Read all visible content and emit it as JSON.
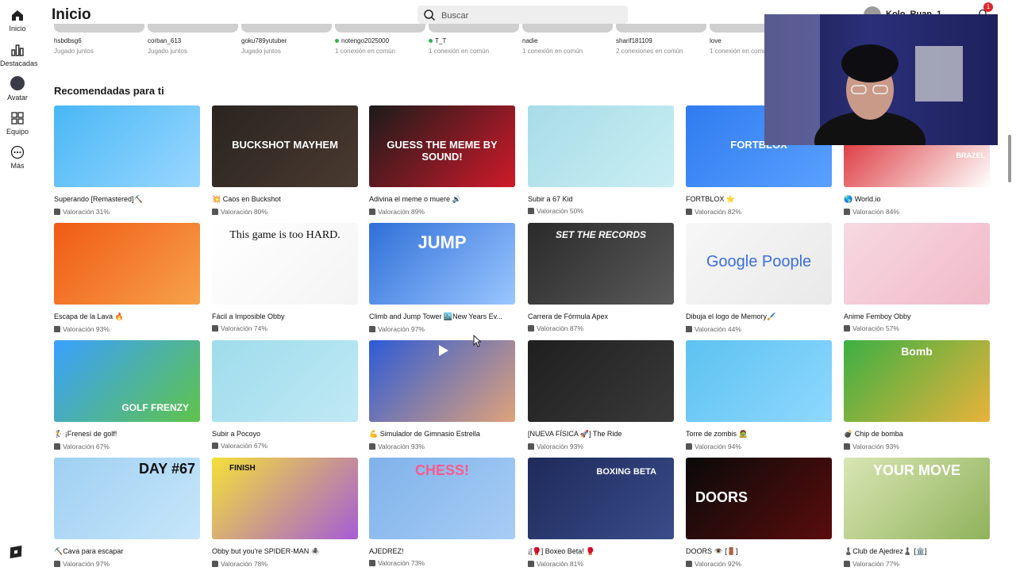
{
  "app": {
    "page_title": "Inicio",
    "user_name": "Kolo_Ruan_1",
    "notifications": "1"
  },
  "search": {
    "placeholder": "Buscar"
  },
  "sidebar": {
    "items": [
      {
        "label": "Inicio",
        "icon": "home-icon"
      },
      {
        "label": "Destacadas",
        "icon": "charts-icon"
      },
      {
        "label": "Avatar",
        "icon": "avatar-icon"
      },
      {
        "label": "Equipo",
        "icon": "inventory-icon"
      },
      {
        "label": "Más",
        "icon": "more-icon"
      }
    ]
  },
  "friends": [
    {
      "name": "hsbdbsg6",
      "status": "Jugado juntos",
      "online": false
    },
    {
      "name": "corban_613",
      "status": "Jugado juntos",
      "online": false
    },
    {
      "name": "goku789yutuber",
      "status": "Jugado juntos",
      "online": false
    },
    {
      "name": "notengo2025000",
      "status": "1 conexión en común",
      "online": true
    },
    {
      "name": "T_T",
      "status": "1 conexión en común",
      "online": true
    },
    {
      "name": "nadie",
      "status": "1 conexión en común",
      "online": false
    },
    {
      "name": "sharif181109",
      "status": "2 conexiones en común",
      "online": false
    },
    {
      "name": "love",
      "status": "1 conexión en común",
      "online": false
    }
  ],
  "recommended": {
    "title": "Recomendadas para ti",
    "games": [
      {
        "title": "Superando [Remastered]⛏️",
        "rating": "Valoración 31%",
        "thumb_text": "",
        "colors": [
          "#49b7f5",
          "#9ad7ff"
        ]
      },
      {
        "title": "💥 Caos en Buckshot",
        "rating": "Valoración 80%",
        "thumb_text": "BUCKSHOT MAYHEM",
        "colors": [
          "#2a2420",
          "#4a3a30"
        ]
      },
      {
        "title": "Adivina el meme o muere 🔊",
        "rating": "Valoración 89%",
        "thumb_text": "GUESS THE MEME BY SOUND!",
        "colors": [
          "#1b1b1b",
          "#d01a2a"
        ]
      },
      {
        "title": "Subir a 67 Kid",
        "rating": "Valoración 50%",
        "thumb_text": "",
        "colors": [
          "#a8dce8",
          "#c9eef3"
        ]
      },
      {
        "title": "FORTBLOX ⭐",
        "rating": "Valoración 82%",
        "thumb_text": "FORTBLOX",
        "colors": [
          "#2f7cf0",
          "#5aa0ff"
        ]
      },
      {
        "title": "🌎 World.io",
        "rating": "Valoración 84%",
        "thumb_text": "BRAZEL",
        "colors": [
          "#d71920",
          "#ffffff"
        ]
      },
      {
        "title": "Escapa de la Lava 🔥",
        "rating": "Valoración 93%",
        "thumb_text": "",
        "colors": [
          "#f05a14",
          "#f7a24a"
        ]
      },
      {
        "title": "Fácil a Imposible Obby",
        "rating": "Valoración 74%",
        "thumb_text": "This game is too HARD.",
        "colors": [
          "#ffffff",
          "#f4f4f4"
        ]
      },
      {
        "title": "Climb and Jump Tower 🏙️New Years Ev...",
        "rating": "Valoración 97%",
        "thumb_text": "JUMP",
        "colors": [
          "#2f6fd8",
          "#9bc7ff"
        ]
      },
      {
        "title": "Carrera de Fórmula Apex",
        "rating": "Valoración 87%",
        "thumb_text": "SET THE RECORDS",
        "colors": [
          "#2a2a2a",
          "#5a5a5a"
        ]
      },
      {
        "title": "Dibuja el logo de Memory🖌️",
        "rating": "Valoración 44%",
        "thumb_text": "Google Poople",
        "colors": [
          "#f7f7f7",
          "#e9e9e9"
        ]
      },
      {
        "title": "Anime Femboy Obby",
        "rating": "Valoración 57%",
        "thumb_text": "",
        "colors": [
          "#f7d9e1",
          "#f0b9c8"
        ]
      },
      {
        "title": "🏌️ ¡Frenesí de golf!",
        "rating": "Valoración 67%",
        "thumb_text": "GOLF FRENZY",
        "colors": [
          "#3aa0ff",
          "#5fc34a"
        ]
      },
      {
        "title": "Subir a Pocoyo",
        "rating": "Valoración 67%",
        "thumb_text": "",
        "colors": [
          "#9fdcec",
          "#bfe9f4"
        ]
      },
      {
        "title": "💪 Simulador de Gimnasio Estrella",
        "rating": "Valoración 93%",
        "thumb_text": "",
        "colors": [
          "#2d5bd6",
          "#e0a27a"
        ]
      },
      {
        "title": "[NUEVA FÍSICA 🚀] The Ride",
        "rating": "Valoración 93%",
        "thumb_text": "",
        "colors": [
          "#1f1f1f",
          "#3a3a3a"
        ]
      },
      {
        "title": "Torre de zombis 🧟",
        "rating": "Valoración 94%",
        "thumb_text": "",
        "colors": [
          "#5dc2f0",
          "#8ed8ff"
        ]
      },
      {
        "title": "💣 Chip de bomba",
        "rating": "Valoración 93%",
        "thumb_text": "Bomb",
        "colors": [
          "#3cb043",
          "#e8b23a"
        ]
      },
      {
        "title": "⛏️Cava para escapar",
        "rating": "Valoración 97%",
        "thumb_text": "DAY #67",
        "colors": [
          "#9fd0f2",
          "#c7e6fa"
        ]
      },
      {
        "title": "Obby but you're SPIDER-MAN 🕷️",
        "rating": "Valoración 78%",
        "thumb_text": "FINISH",
        "colors": [
          "#f4e038",
          "#a65cd6"
        ]
      },
      {
        "title": "AJEDREZ!",
        "rating": "Valoración 73%",
        "thumb_text": "CHESS!",
        "colors": [
          "#7fb2ea",
          "#a8cdf5"
        ]
      },
      {
        "title": "¡[🥊] Boxeo Beta! 🥊",
        "rating": "Valoración 81%",
        "thumb_text": "BOXING BETA",
        "colors": [
          "#1e2a5a",
          "#3a4c8a"
        ]
      },
      {
        "title": "DOORS 👁️ [🚪]",
        "rating": "Valoración 92%",
        "thumb_text": "DOORS",
        "colors": [
          "#0a0a0a",
          "#5a0c0c"
        ]
      },
      {
        "title": "♟️Club de Ajedrez♟️ [🏛️]",
        "rating": "Valoración 77%",
        "thumb_text": "YOUR MOVE",
        "colors": [
          "#d9e6b4",
          "#8fb25a"
        ]
      }
    ]
  }
}
